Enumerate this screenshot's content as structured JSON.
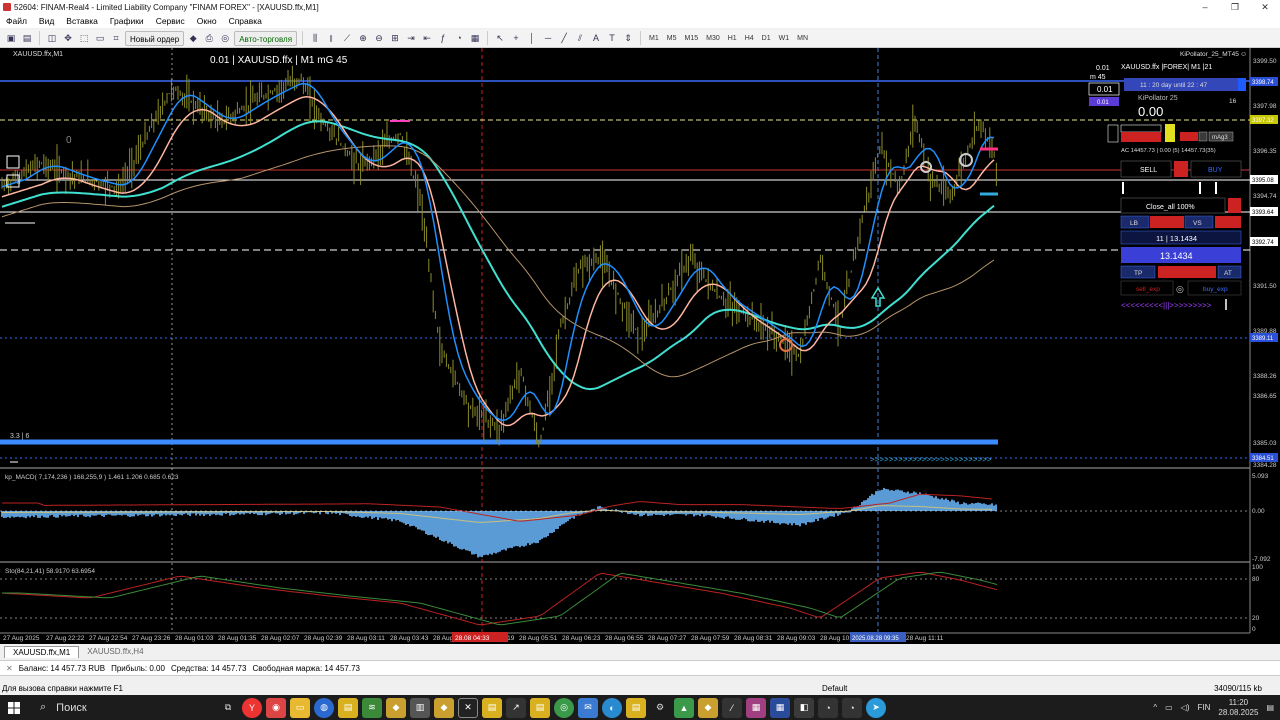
{
  "window": {
    "title": "52604: FINAM-Real4 - Limited Liability Company \"FINAM FOREX\" - [XAUUSD.ffx,M1]",
    "controls": [
      "–",
      "❐",
      "✕"
    ]
  },
  "menu": [
    "Файл",
    "Вид",
    "Вставка",
    "Графики",
    "Сервис",
    "Окно",
    "Справка"
  ],
  "toolbar": {
    "new_order": "Новый ордер",
    "auto_trading": "Авто-торговля",
    "timeframes": [
      "M1",
      "M5",
      "M15",
      "M30",
      "H1",
      "H4",
      "D1",
      "W1",
      "MN"
    ]
  },
  "chart": {
    "symbol_label": "XAUUSD.ffx,M1",
    "header_text": "0.01 | XAUUSD.ffx | M1 mG 45",
    "ea_name": "KiPollator_25_MT45",
    "left_info": "3.3 | 6",
    "zero_label": "0",
    "price_axis": [
      "3399.50",
      "3397.98",
      "3396.35",
      "3394.74",
      "3393.12",
      "3391.50",
      "3389.88",
      "3388.26",
      "3386.65",
      "3385.03",
      "3384.28"
    ],
    "price_tags": [
      {
        "text": "3398.74",
        "color": "#2b4fd6"
      },
      {
        "text": "3397.32",
        "color": "#c8c800"
      },
      {
        "text": "3395.08",
        "color": "#ffffff"
      },
      {
        "text": "3393.64",
        "color": "#ffffff"
      },
      {
        "text": "3392.74",
        "color": "#ffffff"
      },
      {
        "text": "3389.11",
        "color": "#2b4fd6"
      },
      {
        "text": "3384.51",
        "color": "#2b4fd6"
      }
    ],
    "time_axis": [
      "27 Aug 2025",
      "27 Aug 22:22",
      "27 Aug 22:54",
      "27 Aug 23:26",
      "28 Aug 01:03",
      "28 Aug 01:35",
      "28 Aug 02:07",
      "28 Aug 02:39",
      "28 Aug 03:11",
      "28 Aug 03:43",
      "28 Aug 04:15",
      "28 Aug 05:19",
      "28 Aug 05:51",
      "28 Aug 06:23",
      "28 Aug 06:55",
      "28 Aug 07:27",
      "28 Aug 07:59",
      "28 Aug 08:31",
      "28 Aug 09:03",
      "28 Aug 10:07",
      "28 Aug 10:39",
      "28 Aug 11:11"
    ],
    "time_highlight_red": "28.08 04:33",
    "time_highlight_blue": "2025.08.28 09:35"
  },
  "panel": {
    "lot": "0.01",
    "m_label": "m 45",
    "lot_box": "0.01",
    "lot_box2": "0.01",
    "symbol_line": "XAUUSD.ffx |FOREX| M1 |21",
    "countdown": "11 : 20  day until 22 : 47",
    "title": "KiPollator 25",
    "number_16": "16",
    "price_display": "0.00",
    "ac_line": "AC 14457.73 | 0.00 (5) 14457.73(35)",
    "sell_label": "SELL",
    "buy_label": "BUY",
    "close_all": "Close_all 100%",
    "btn_lb": "LB",
    "btn_vs": "VS",
    "lot_line": "11 | 13.1434",
    "big_value": "13.1434",
    "btn_tp": "TP",
    "btn_at": "AT",
    "sell_exp": "sell_exp",
    "buy_exp": "buy_exp",
    "mag_label": "mAg3"
  },
  "macd": {
    "label": "kp_MACD( 7,174,236 ) 168,255,9 ) 1.461 1.206 0.685 0.623",
    "axis": [
      "5.093",
      "0.00",
      "-7.092"
    ]
  },
  "stoch": {
    "label": "Sto(84,21,41) 58.9170 63.6954",
    "axis": [
      "100",
      "80",
      "20",
      "0"
    ]
  },
  "tabs": [
    "XAUUSD.ffx,M1",
    "XAUUSD.ffx,H4"
  ],
  "account": {
    "balance": "Баланс: 14 457.73 RUB",
    "profit": "Прибыль: 0.00",
    "equity": "Средства: 14 457.73",
    "free_margin": "Свободная маржа: 14 457.73"
  },
  "status": {
    "help": "Для вызова справки нажмите F1",
    "profile": "Default",
    "traffic": "34090/115 kb"
  },
  "taskbar": {
    "search": "Поиск",
    "lang": "FIN",
    "time": "11:20",
    "date": "28.08.2025"
  },
  "colors": {
    "chart_bg": "#000000",
    "macd_hist": "#5b9bd5",
    "blue_line": "#1e90ff",
    "ma_cyan": "#40e0d0",
    "ma_pink": "#ffb6a0",
    "candle": "#8b8b2b",
    "support": "#3b8bff"
  }
}
